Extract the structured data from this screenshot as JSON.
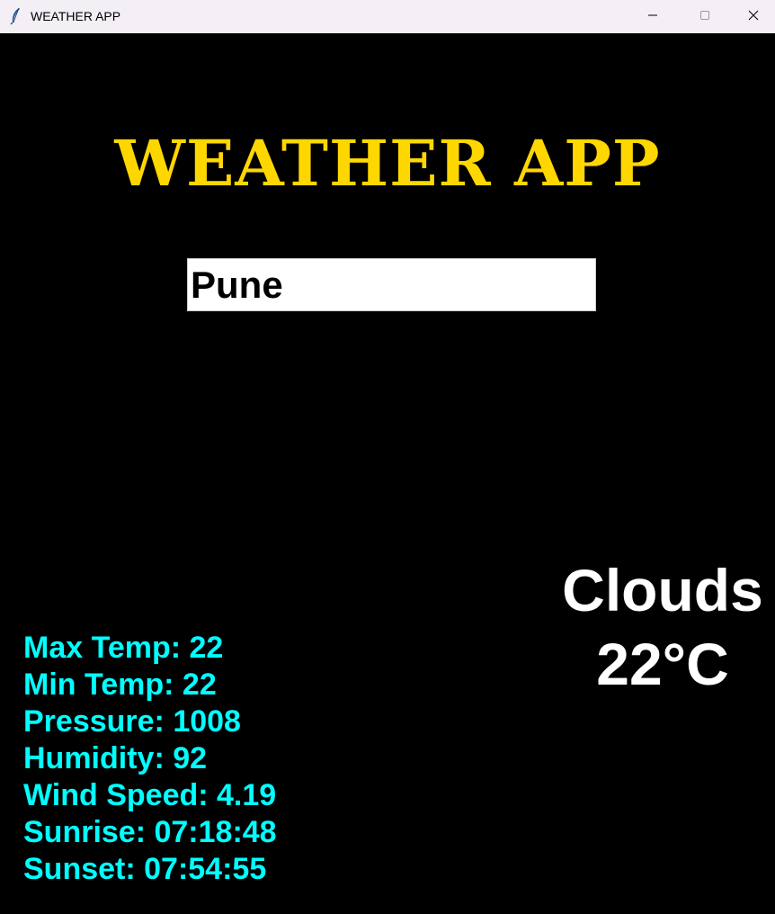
{
  "window": {
    "title": "WEATHER APP",
    "icon": "feather-icon",
    "controls": [
      "minimize-icon",
      "maximize-icon",
      "close-icon"
    ]
  },
  "app": {
    "heading": "WEATHER APP",
    "heading_color": "#FFD700",
    "background_color": "#000000"
  },
  "search": {
    "value": "Pune",
    "placeholder": ""
  },
  "current": {
    "condition": "Clouds",
    "temperature": "22°C",
    "text_color": "#FFFFFF"
  },
  "details": {
    "text_color": "#00FFFF",
    "rows": [
      "Max Temp: 22",
      "Min Temp: 22",
      "Pressure: 1008",
      "Humidity: 92",
      "Wind Speed: 4.19",
      "Sunrise: 07:18:48",
      "Sunset: 07:54:55"
    ]
  }
}
